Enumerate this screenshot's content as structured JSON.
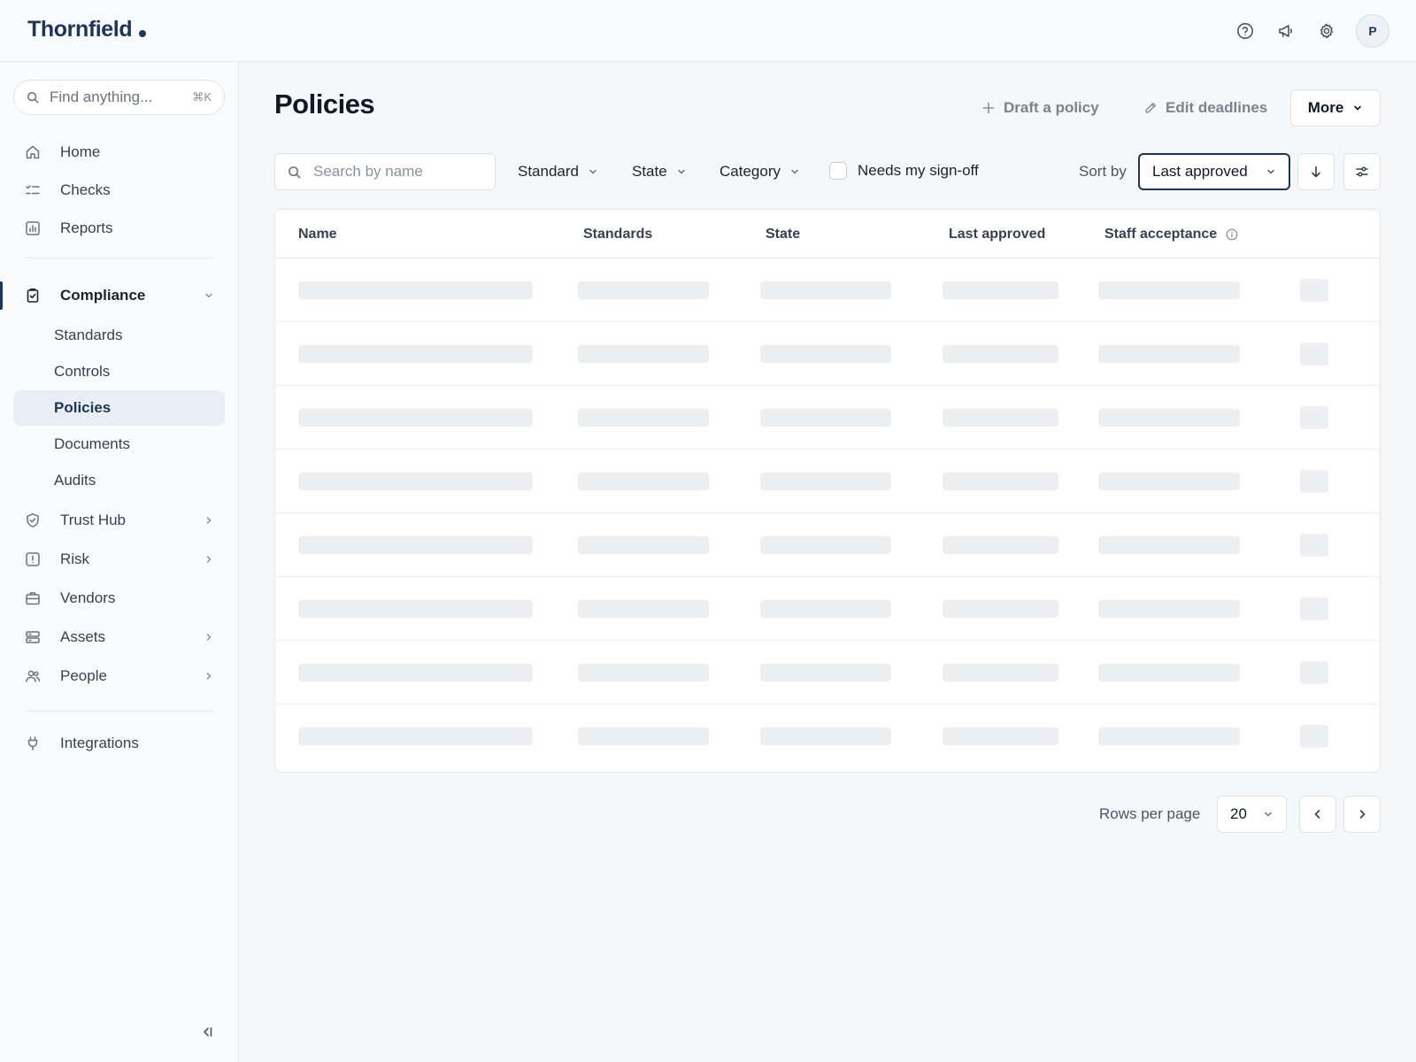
{
  "app": {
    "brand": "Thornfield"
  },
  "header": {
    "icons": [
      "help-circle-icon",
      "megaphone-icon",
      "gear-icon"
    ],
    "avatar_initial": "P"
  },
  "sidebar": {
    "search_placeholder": "Find anything...",
    "search_shortcut": "⌘K",
    "items": [
      {
        "label": "Home",
        "icon": "home-icon"
      },
      {
        "label": "Checks",
        "icon": "checklist-icon"
      },
      {
        "label": "Reports",
        "icon": "bar-chart-icon"
      },
      {
        "label": "Compliance",
        "icon": "clipboard-check-icon",
        "expanded": true,
        "children": [
          "Standards",
          "Controls",
          "Policies",
          "Documents",
          "Audits"
        ],
        "active_child": "Policies"
      },
      {
        "label": "Trust Hub",
        "icon": "shield-check-icon"
      },
      {
        "label": "Risk",
        "icon": "alert-square-icon"
      },
      {
        "label": "Vendors",
        "icon": "briefcase-icon"
      },
      {
        "label": "Assets",
        "icon": "server-icon"
      },
      {
        "label": "People",
        "icon": "users-icon"
      },
      {
        "label": "Integrations",
        "icon": "plug-icon"
      }
    ]
  },
  "main": {
    "title": "Policies",
    "actions": {
      "draft": "Draft a policy",
      "edit_deadlines": "Edit deadlines",
      "more": "More"
    },
    "filters": {
      "search_placeholder": "Search by name",
      "standard": "Standard",
      "state": "State",
      "category": "Category",
      "needs_signoff": "Needs my sign-off",
      "needs_signoff_checked": false,
      "sort_label": "Sort by",
      "sort_value": "Last approved"
    },
    "table": {
      "columns": [
        "Name",
        "Standards",
        "State",
        "Last approved",
        "Staff acceptance"
      ],
      "loading": true
    },
    "pagination": {
      "rows_per_page_label": "Rows per page",
      "rows_per_page": "20"
    }
  },
  "colors": {
    "brand": "#1d3557",
    "active_nav_bg": "#e9eef6",
    "skeleton": "#eceef1"
  }
}
